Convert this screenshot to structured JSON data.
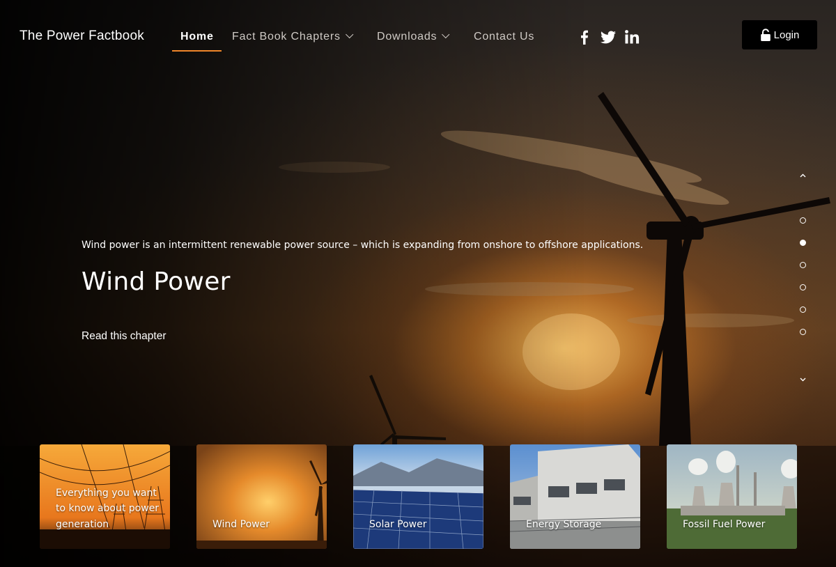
{
  "header": {
    "site_title": "The Power Factbook",
    "nav": [
      {
        "label": "Home",
        "active": true,
        "has_dropdown": false
      },
      {
        "label": "Fact Book Chapters",
        "active": false,
        "has_dropdown": true
      },
      {
        "label": "Downloads",
        "active": false,
        "has_dropdown": true
      },
      {
        "label": "Contact Us",
        "active": false,
        "has_dropdown": false
      }
    ],
    "social_icons": [
      "facebook-icon",
      "twitter-icon",
      "linkedin-icon"
    ],
    "login_label": "Login",
    "login_icon": "unlock-icon"
  },
  "hero": {
    "tagline": "Wind power is an intermittent renewable power source – which is expanding from onshore to offshore applications.",
    "heading": "Wind Power",
    "link_label": "Read this chapter"
  },
  "slider": {
    "total_slides": 6,
    "active_index": 1
  },
  "cards": [
    {
      "label": "Everything you want to know about power generation"
    },
    {
      "label": "Wind Power"
    },
    {
      "label": "Solar Power"
    },
    {
      "label": "Energy Storage"
    },
    {
      "label": "Fossil Fuel Power"
    }
  ],
  "colors": {
    "accent": "#f0862a",
    "login_bg": "#000000",
    "nav_text": "#cfcac5"
  }
}
